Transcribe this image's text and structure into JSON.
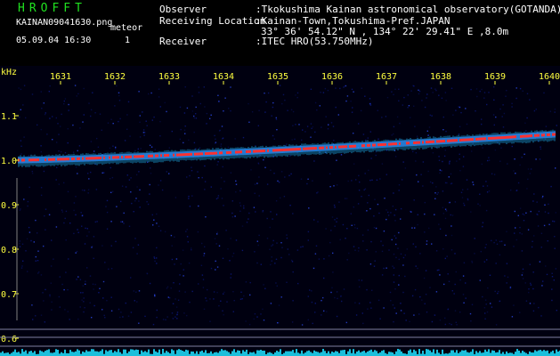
{
  "header": {
    "title": "HROFFT",
    "filename": "KAINAN09041630.png",
    "date_time": "05.09.04 16:30",
    "meteor_label": "meteor",
    "meteor_count": "1",
    "observer_label": "Observer",
    "observer_value": ":Tkokushima Kainan astronomical observatory(GOTANDA)",
    "location_label": "Receiving Location",
    "location_value": ":Kainan-Town,Tokushima-Pref.JAPAN",
    "coords_value": "33° 36' 54.12\" N , 134° 22' 29.41\" E ,8.0m",
    "receiver_label": "Receiver",
    "receiver_value": ":ITEC HRO(53.750MHz)"
  },
  "spectrogram": {
    "y_unit": "kHz",
    "y_ticks": [
      "1.1",
      "1.0",
      "0.9",
      "0.8",
      "0.7",
      "0.6"
    ],
    "x_ticks": [
      "1631",
      "1632",
      "1633",
      "1634",
      "1635",
      "1636",
      "1637",
      "1638",
      "1639",
      "1640"
    ],
    "colors": {
      "background": "#000010",
      "noise": "#1020a0",
      "echo_core": "#ff3030",
      "echo_halo": "#20c0ff",
      "bottom_band": "#20e0ff"
    }
  }
}
